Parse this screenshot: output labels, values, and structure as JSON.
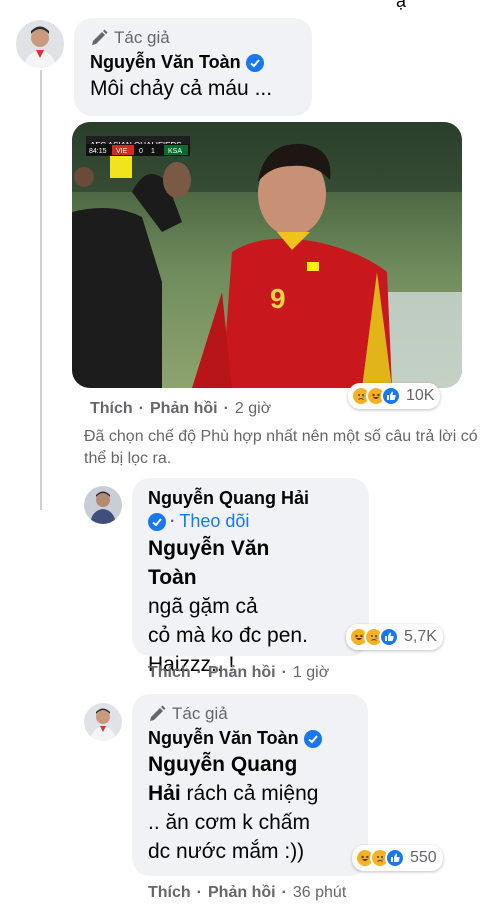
{
  "comments": [
    {
      "author_tag": "Tác giả",
      "author": "Nguyễn Văn Toàn",
      "text": "Môi chảy cả máu ...",
      "like_label": "Thích",
      "reply_label": "Phản hồi",
      "time": "2 giờ",
      "reaction_count": "10K",
      "reactions": [
        "sad-reaction",
        "haha-reaction",
        "like-reaction"
      ],
      "image": {
        "scoreboard": {
          "competition": "AFC ASIAN QUALIFIERS",
          "clock": "84:15",
          "home": "VIE",
          "home_score": "0",
          "away_score": "1",
          "away": "KSA"
        },
        "jersey_number": "9"
      }
    }
  ],
  "filter_note": "Đã chọn chế độ Phù hợp nhất nên một số câu trả lời có thể bị lọc ra.",
  "replies": [
    {
      "author": "Nguyễn Quang Hải",
      "follow_label": "Theo dõi",
      "mention": "Nguyễn Văn Toàn",
      "text_lines": [
        "ngã gặm cả",
        "cỏ mà ko đc pen.",
        "Haizzz...!"
      ],
      "like_label": "Thích",
      "reply_label": "Phản hồi",
      "time": "1 giờ",
      "reaction_count": "5,7K",
      "reactions": [
        "haha-reaction",
        "sad-reaction",
        "like-reaction"
      ]
    },
    {
      "author_tag": "Tác giả",
      "author": "Nguyễn Văn Toàn",
      "mention": "Nguyễn Quang",
      "mention_line2": "Hải",
      "text_line1": "rách cả miệng",
      "text_lines": [
        ".. ăn cơm k chấm",
        "dc nước mắm :))"
      ],
      "like_label": "Thích",
      "reply_label": "Phản hồi",
      "time": "36 phút",
      "reaction_count": "550",
      "reactions": [
        "haha-reaction",
        "sad-reaction",
        "like-reaction"
      ]
    }
  ],
  "colors": {
    "bubble": "#f0f2f5",
    "secondary_text": "#65676b",
    "link": "#1877f2",
    "verified": "#1877f2",
    "like": "#1877f2",
    "emoji_yellow": "#f7b125"
  }
}
